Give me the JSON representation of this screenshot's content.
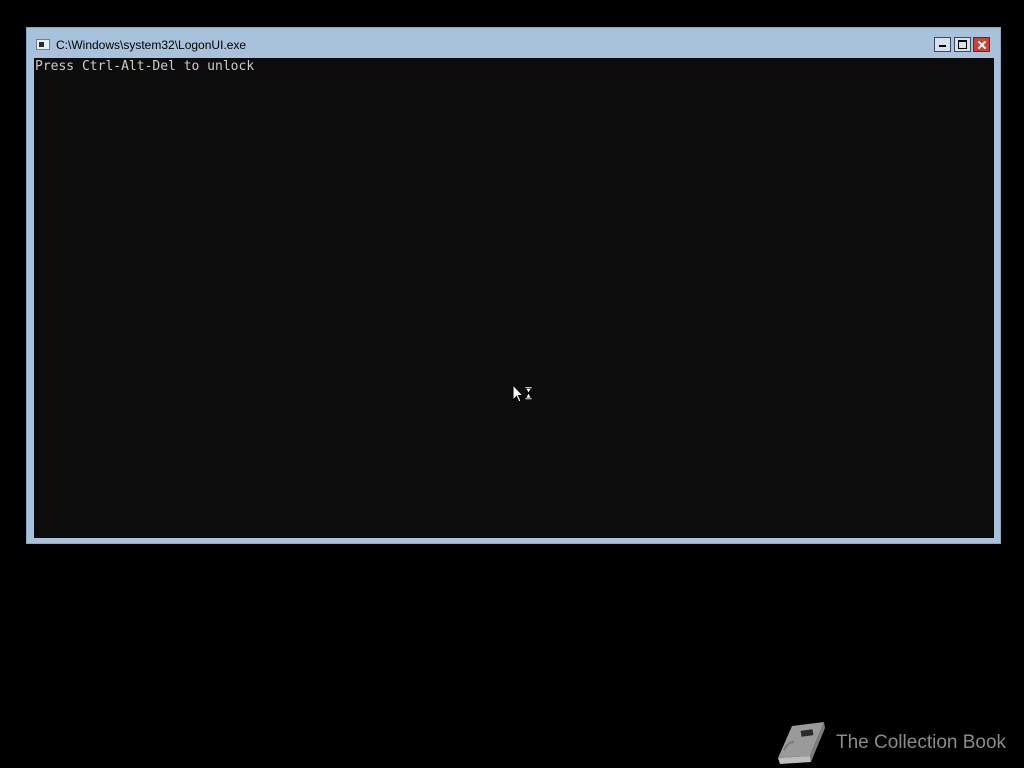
{
  "window": {
    "title": "C:\\Windows\\system32\\LogonUI.exe",
    "icon": "console-app-icon",
    "controls": {
      "minimize": "minimize-icon",
      "maximize": "maximize-icon",
      "close": "close-icon"
    }
  },
  "console": {
    "lines": [
      "Press Ctrl-Alt-Del to unlock"
    ]
  },
  "cursor": {
    "icon": "busy-pointer-icon"
  },
  "watermark": {
    "logo": "book-icon",
    "text": "The Collection Book"
  },
  "colors": {
    "desktop_background": "#000000",
    "window_frame": "#a9c2dc",
    "console_background": "#0c0c0c",
    "console_text": "#cccccc",
    "close_button": "#c9423a",
    "watermark_text": "#8a8a8a"
  }
}
